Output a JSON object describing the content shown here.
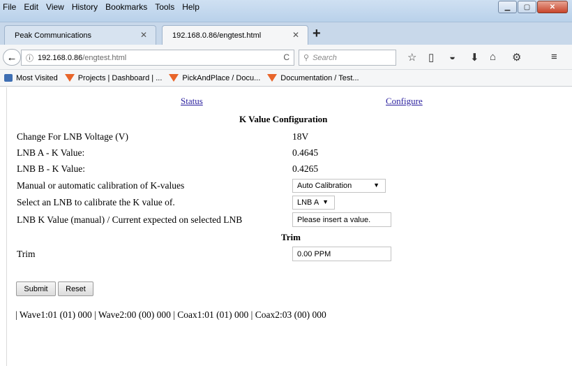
{
  "menu": [
    "File",
    "Edit",
    "View",
    "History",
    "Bookmarks",
    "Tools",
    "Help"
  ],
  "tabs": [
    {
      "label": "Peak Communications"
    },
    {
      "label": "192.168.0.86/engtest.html"
    }
  ],
  "url": {
    "host": "192.168.0.86",
    "path": "/engtest.html"
  },
  "search": {
    "placeholder": "Search"
  },
  "bookmarks": [
    "Most Visited",
    "Projects | Dashboard | ...",
    "PickAndPlace / Docu...",
    "Documentation / Test..."
  ],
  "nav": {
    "status": "Status",
    "configure": "Configure"
  },
  "kvalue": {
    "heading": "K Value Configuration",
    "voltage_label": "Change For LNB Voltage (V)",
    "voltage_value": "18V",
    "lnba_label": "LNB A - K Value:",
    "lnba_value": "0.4645",
    "lnbb_label": "LNB B - K Value:",
    "lnbb_value": "0.4265",
    "calib_label": "Manual or automatic calibration of K-values",
    "calib_value": "Auto Calibration",
    "select_label": "Select an LNB to calibrate the K value of.",
    "select_value": "LNB A",
    "manual_label": "LNB K Value (manual) / Current expected on selected LNB",
    "manual_value": "Please insert a value."
  },
  "trim": {
    "heading": "Trim",
    "label": "Trim",
    "value": "0.00 PPM"
  },
  "buttons": {
    "submit": "Submit",
    "reset": "Reset"
  },
  "status_line": "| Wave1:01 (01) 000 | Wave2:00 (00) 000 | Coax1:01 (01) 000 | Coax2:03 (00) 000"
}
